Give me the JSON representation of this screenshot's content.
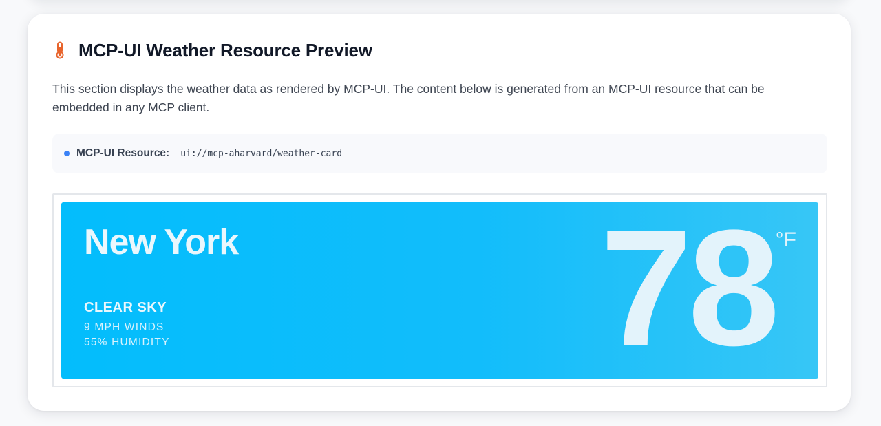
{
  "section": {
    "title": "MCP-UI Weather Resource Preview",
    "icon": "thermometer-icon",
    "icon_color": "#e8642c",
    "description": "This section displays the weather data as rendered by MCP-UI. The content below is generated from an MCP-UI resource that can be embedded in any MCP client."
  },
  "resource": {
    "label": "MCP-UI Resource:",
    "uri": "ui://mcp-aharvard/weather-card",
    "dot_color": "#3b82f6"
  },
  "weather": {
    "city": "New York",
    "condition": "CLEAR SKY",
    "winds": "9 MPH WINDS",
    "humidity": "55% HUMIDITY",
    "temperature": "78",
    "unit": "°F",
    "background_color": "#03bdfc"
  }
}
